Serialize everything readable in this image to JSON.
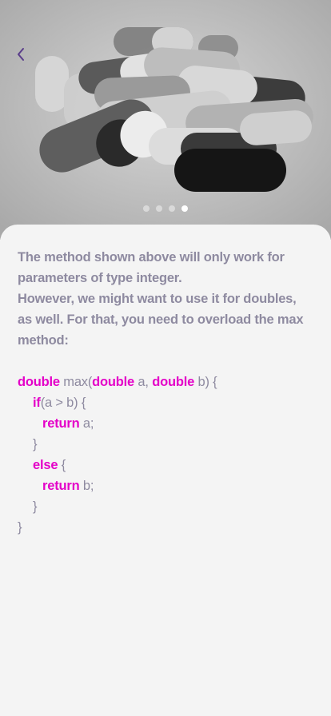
{
  "navigation": {
    "back_icon": "chevron-left-icon"
  },
  "carousel": {
    "slide_count": 4,
    "active_index": 3
  },
  "colors": {
    "text": "#8e8aa0",
    "keyword": "#e400c8",
    "background": "#f4f4f4"
  },
  "article": {
    "paragraph_1": "The method shown above will only work for parameters of type integer.",
    "paragraph_2": "However, we might want to use it for doubles, as well. For that, you need to overload the max method:"
  },
  "code": {
    "l1_kw1": "double",
    "l1_t1": " max(",
    "l1_kw2": "double",
    "l1_t2": " a, ",
    "l1_kw3": "double",
    "l1_t3": " b) {",
    "l2_kw": "if",
    "l2_t": "(a > b) {",
    "l3_kw": "return",
    "l3_t": " a;",
    "l4_t": "}",
    "l5_kw": "else",
    "l5_t": " {",
    "l6_kw": "return",
    "l6_t": " b;",
    "l7_t": "}",
    "l8_t": "}"
  }
}
